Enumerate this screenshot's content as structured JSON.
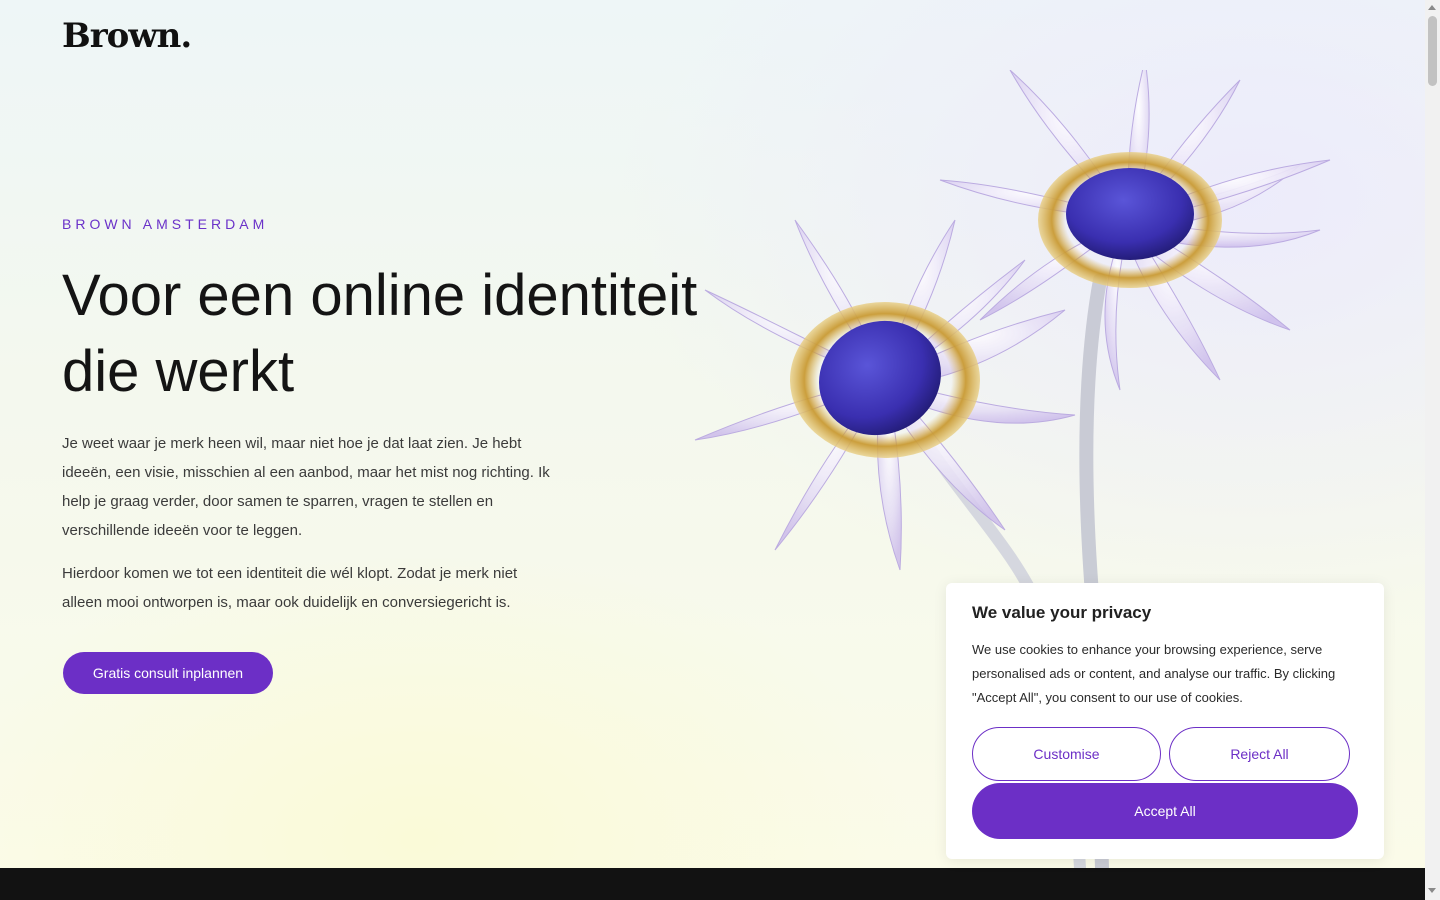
{
  "brand": {
    "logo": "Brown."
  },
  "hero": {
    "eyebrow": "BROWN AMSTERDAM",
    "headline": "Voor een online identiteit die werkt",
    "paragraph1": "Je weet waar je merk heen wil, maar niet hoe je dat laat zien. Je hebt ideeën, een visie, misschien al een aanbod, maar het mist nog richting. Ik help je graag verder, door samen te sparren, vragen te stellen en verschillende ideeën voor te leggen.",
    "paragraph2": "Hierdoor komen we tot een identiteit die wél klopt. Zodat je merk niet alleen mooi ontworpen is, maar ook duidelijk en conversiegericht is.",
    "cta_label": "Gratis consult inplannen"
  },
  "cookie_banner": {
    "title": "We value your privacy",
    "text": "We use cookies to enhance your browsing experience, serve personalised ads or content, and analyse our traffic. By clicking \"Accept All\", you consent to our use of cookies.",
    "customise_label": "Customise",
    "reject_label": "Reject All",
    "accept_label": "Accept All"
  },
  "colors": {
    "accent": "#6c2fc6",
    "footer": "#121212",
    "flower_center": "#3a2fb0"
  },
  "icons": {
    "hero_image": "glass-flowers-illustration"
  }
}
